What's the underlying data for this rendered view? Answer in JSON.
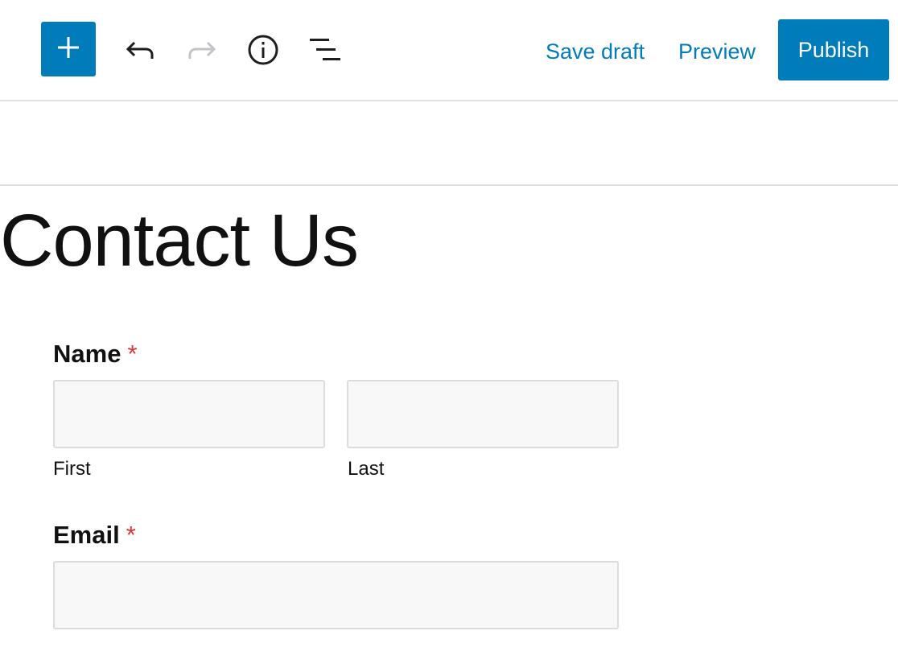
{
  "toolbar": {
    "inserter_icon": "plus-icon",
    "undo_icon": "undo-icon",
    "redo_icon": "redo-icon",
    "details_icon": "info-icon",
    "outline_icon": "list-view-icon",
    "save_draft_label": "Save draft",
    "preview_label": "Preview",
    "publish_label": "Publish"
  },
  "colors": {
    "accent": "#007cba",
    "required": "#d63638",
    "input_bg": "#f8f8f8",
    "input_border": "#dcdcdc",
    "divider": "#e0e0e0",
    "redo_disabled": "#c3c4c7"
  },
  "post": {
    "title": "Contact Us"
  },
  "form": {
    "name": {
      "label": "Name",
      "required_mark": "*",
      "first_value": "",
      "first_sublabel": "First",
      "last_value": "",
      "last_sublabel": "Last"
    },
    "email": {
      "label": "Email",
      "required_mark": "*",
      "value": ""
    }
  }
}
